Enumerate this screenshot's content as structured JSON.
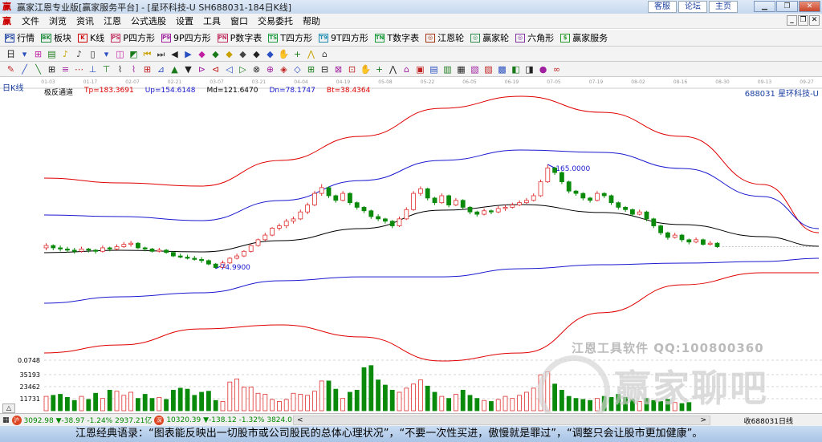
{
  "window": {
    "title": "赢家江恩专业版[赢家服务平台] - [星环科技-U  SH688031-184日K线]",
    "links": [
      "客服",
      "论坛",
      "主页"
    ],
    "controls": [
      "minimize",
      "restore",
      "close"
    ]
  },
  "menu": [
    "文件",
    "浏览",
    "资讯",
    "江恩",
    "公式选股",
    "设置",
    "工具",
    "窗口",
    "交易委托",
    "帮助"
  ],
  "toolbar1": [
    {
      "icon": "PS",
      "label": "行情",
      "color": "#1a3fa0"
    },
    {
      "icon": "BK",
      "label": "板块",
      "color": "#1a8a3a"
    },
    {
      "icon": "K",
      "label": "K线",
      "color": "#c00"
    },
    {
      "icon": "PS",
      "label": "P四方形",
      "color": "#c03060"
    },
    {
      "icon": "P9",
      "label": "9P四方形",
      "color": "#a020a0"
    },
    {
      "icon": "PN",
      "label": "P数字表",
      "color": "#c03060"
    },
    {
      "icon": "TS",
      "label": "T四方形",
      "color": "#1a9a3a"
    },
    {
      "icon": "T9",
      "label": "9T四方形",
      "color": "#1a8ab0"
    },
    {
      "icon": "TN",
      "label": "T数字表",
      "color": "#1a9a3a"
    },
    {
      "icon": "◎",
      "label": "江恩轮",
      "color": "#a03010"
    },
    {
      "icon": "◎",
      "label": "赢家轮",
      "color": "#2a8a4a"
    },
    {
      "icon": "◎",
      "label": "六角形",
      "color": "#8030a0"
    },
    {
      "icon": "$",
      "label": "赢家服务",
      "color": "#2a9a2a"
    }
  ],
  "toolbar2_icons": [
    "日",
    "▾",
    "⊞",
    "▤",
    "♪",
    "♪",
    "▯",
    "▾",
    "◫",
    "◩",
    "⏮",
    "⏭",
    "◀",
    "▶",
    "◆",
    "◆",
    "◆",
    "◆",
    "◆",
    "◆",
    "✋",
    "+",
    "⋀",
    "⌂"
  ],
  "toolbar3_icons": [
    "✎",
    "╱",
    "╲",
    "⊞",
    "≡",
    "⋯",
    "⊥",
    "⊤",
    "⌇",
    "⌇",
    "⊞",
    "⊿",
    "▲",
    "▼",
    "⊳",
    "⊲",
    "◁",
    "▷",
    "⊗",
    "⊕",
    "◈",
    "◇",
    "⊞",
    "⊟",
    "⊠",
    "⊡",
    "✋",
    "+",
    "⋀",
    "⌂",
    "▣",
    "▤",
    "▥",
    "▦",
    "▧",
    "▨",
    "▩",
    "◧",
    "◨",
    "●",
    "∞"
  ],
  "chart": {
    "period_label": "日K线",
    "indicator_name": "极反通道",
    "legend": [
      {
        "text": "Tp=183.3691",
        "color": "#e00000"
      },
      {
        "text": "Up=154.6148",
        "color": "#1a1ad0"
      },
      {
        "text": "Md=121.6470",
        "color": "#000000"
      },
      {
        "text": "Dn=78.1747",
        "color": "#1a1ad0"
      },
      {
        "text": "Bt=38.4364",
        "color": "#e00000"
      }
    ],
    "stock_label": "688031  星环科技-U",
    "high_label": "165.0000",
    "low_label": "74.9900",
    "watermark": {
      "line1": "江恩工具软件  QQ:100800360",
      "line2": "赢家聊吧",
      "seal": "财赢"
    }
  },
  "chart_data": {
    "type": "candlestick",
    "x_ticks": [
      "01-03",
      "01-17",
      "02-07",
      "02-21",
      "03-07",
      "03-21",
      "04-04",
      "04-19",
      "05-08",
      "05-22",
      "06-05",
      "06-19",
      "07-05",
      "07-19",
      "08-02",
      "08-16",
      "08-30",
      "09-13",
      "09-27"
    ],
    "candles": [
      [
        93,
        97,
        91,
        95
      ],
      [
        95,
        96,
        91,
        93
      ],
      [
        93,
        95,
        90,
        92
      ],
      [
        92,
        94,
        89,
        91
      ],
      [
        91,
        93,
        88,
        90
      ],
      [
        90,
        94,
        89,
        92
      ],
      [
        92,
        93,
        89,
        91
      ],
      [
        91,
        92,
        88,
        90
      ],
      [
        90,
        95,
        89,
        93
      ],
      [
        93,
        94,
        90,
        92
      ],
      [
        92,
        96,
        91,
        94
      ],
      [
        94,
        98,
        93,
        96
      ],
      [
        96,
        99,
        94,
        97
      ],
      [
        97,
        98,
        92,
        93
      ],
      [
        93,
        94,
        90,
        92
      ],
      [
        92,
        93,
        89,
        90
      ],
      [
        90,
        93,
        89,
        91
      ],
      [
        91,
        92,
        88,
        89
      ],
      [
        89,
        90,
        85,
        86
      ],
      [
        86,
        88,
        84,
        85
      ],
      [
        85,
        87,
        83,
        84
      ],
      [
        84,
        86,
        82,
        83
      ],
      [
        83,
        85,
        80,
        82
      ],
      [
        82,
        83,
        78,
        79
      ],
      [
        79,
        80,
        74.99,
        76
      ],
      [
        76,
        82,
        75,
        80
      ],
      [
        80,
        85,
        79,
        84
      ],
      [
        84,
        88,
        83,
        86
      ],
      [
        86,
        91,
        85,
        90
      ],
      [
        90,
        96,
        89,
        95
      ],
      [
        95,
        101,
        94,
        100
      ],
      [
        100,
        106,
        99,
        104
      ],
      [
        104,
        111,
        103,
        110
      ],
      [
        110,
        114,
        108,
        112
      ],
      [
        112,
        118,
        110,
        116
      ],
      [
        116,
        120,
        114,
        118
      ],
      [
        118,
        126,
        117,
        124
      ],
      [
        124,
        132,
        122,
        130
      ],
      [
        130,
        142,
        129,
        140
      ],
      [
        140,
        148,
        138,
        145
      ],
      [
        145,
        146,
        136,
        138
      ],
      [
        138,
        139,
        132,
        134
      ],
      [
        134,
        142,
        133,
        140
      ],
      [
        140,
        141,
        130,
        132
      ],
      [
        132,
        133,
        126,
        128
      ],
      [
        128,
        129,
        123,
        125
      ],
      [
        125,
        126,
        118,
        120
      ],
      [
        120,
        122,
        116,
        118
      ],
      [
        118,
        119,
        114,
        116
      ],
      [
        116,
        117,
        110,
        112
      ],
      [
        112,
        120,
        111,
        118
      ],
      [
        118,
        128,
        117,
        126
      ],
      [
        126,
        142,
        125,
        140
      ],
      [
        140,
        146,
        138,
        144
      ],
      [
        144,
        145,
        134,
        136
      ],
      [
        136,
        137,
        130,
        132
      ],
      [
        132,
        140,
        131,
        138
      ],
      [
        138,
        139,
        128,
        130
      ],
      [
        130,
        136,
        129,
        134
      ],
      [
        134,
        135,
        126,
        128
      ],
      [
        128,
        129,
        122,
        124
      ],
      [
        124,
        125,
        120,
        122
      ],
      [
        122,
        127,
        121,
        125
      ],
      [
        125,
        126,
        122,
        124
      ],
      [
        124,
        129,
        123,
        127
      ],
      [
        127,
        130,
        125,
        128
      ],
      [
        128,
        132,
        127,
        130
      ],
      [
        130,
        134,
        129,
        132
      ],
      [
        132,
        136,
        131,
        134
      ],
      [
        134,
        140,
        133,
        138
      ],
      [
        138,
        152,
        137,
        150
      ],
      [
        150,
        165,
        149,
        162
      ],
      [
        162,
        163,
        156,
        158
      ],
      [
        158,
        159,
        148,
        150
      ],
      [
        150,
        151,
        140,
        142
      ],
      [
        142,
        143,
        138,
        140
      ],
      [
        140,
        141,
        134,
        136
      ],
      [
        136,
        137,
        132,
        134
      ],
      [
        134,
        142,
        133,
        140
      ],
      [
        140,
        141,
        136,
        138
      ],
      [
        138,
        139,
        130,
        132
      ],
      [
        132,
        133,
        126,
        128
      ],
      [
        128,
        129,
        124,
        126
      ],
      [
        126,
        127,
        120,
        122
      ],
      [
        122,
        126,
        121,
        124
      ],
      [
        124,
        125,
        116,
        118
      ],
      [
        118,
        119,
        110,
        112
      ],
      [
        112,
        113,
        104,
        106
      ],
      [
        106,
        107,
        100,
        102
      ],
      [
        102,
        106,
        101,
        104
      ],
      [
        104,
        105,
        98,
        100
      ],
      [
        100,
        101,
        96,
        98
      ],
      [
        98,
        102,
        97,
        100
      ],
      [
        100,
        101,
        95,
        96
      ],
      [
        96,
        99,
        95,
        97
      ],
      [
        97,
        98,
        93,
        94
      ]
    ],
    "volume": [
      14000,
      15000,
      16000,
      13000,
      10000,
      14000,
      11000,
      17000,
      12000,
      20000,
      19000,
      15000,
      18000,
      12000,
      16000,
      12000,
      13000,
      11000,
      20000,
      22000,
      21000,
      15000,
      18000,
      19000,
      10000,
      9000,
      28000,
      31000,
      23000,
      23000,
      17000,
      16000,
      11000,
      9000,
      11000,
      17000,
      16000,
      15000,
      19000,
      29000,
      29000,
      21000,
      12000,
      18000,
      20000,
      42000,
      44000,
      30000,
      25000,
      20000,
      18000,
      22000,
      26000,
      30000,
      24000,
      18000,
      14000,
      12000,
      16000,
      20000,
      15000,
      12000,
      10000,
      9000,
      11000,
      14000,
      12000,
      15000,
      18000,
      22000,
      35000,
      38000,
      26000,
      20000,
      14000,
      12000,
      11000,
      10000,
      12000,
      14000,
      13000,
      16000,
      13000,
      11000,
      9000,
      12000,
      10000,
      9000,
      11000,
      8000,
      7000,
      8000
    ],
    "volume_ticks": [
      "11731",
      "23462",
      "35193"
    ],
    "volume_top_label": "0.0748",
    "bands": {
      "tp": [
        153.2,
        149.1,
        146.3,
        168.5,
        189.2,
        213.5,
        223.9,
        210.0,
        189.2,
        147.7,
        106.1
      ],
      "up": [
        121.4,
        120.0,
        116.5,
        133.8,
        151.1,
        168.5,
        177.5,
        175.4,
        161.5,
        137.3,
        109.6
      ],
      "md": [
        88.8,
        90.9,
        89.5,
        99.2,
        109.6,
        125.5,
        130.4,
        123.5,
        113.1,
        102.7,
        94.4
      ],
      "dn": [
        45.2,
        50.7,
        54.2,
        64.6,
        68.0,
        68.0,
        75.0,
        78.4,
        79.8,
        81.2,
        84.0
      ],
      "bt": [
        2.3,
        9.2,
        23.0,
        26.5,
        16.1,
        -4.7,
        2.3,
        37.0,
        61.1,
        71.5,
        71.5
      ]
    },
    "colors": {
      "up": "#e03030",
      "down": "#0a8a0a",
      "tp": "#e00000",
      "upband": "#1a1ad0",
      "md": "#000000",
      "dn": "#1a1ad0",
      "bt": "#e00000"
    }
  },
  "statusbar": {
    "sh_badge": "沪",
    "sh_quote": "3092.98 ▼-38.97 -1.24% 2937.21亿",
    "sz_badge": "深",
    "sz_quote": "10320.39 ▼-138.12 -1.32% 3824.0",
    "right_text": "收688031日线"
  },
  "banner": "江恩经典语录：“图表能反映出一切股市或公司股民的总体心理状况”，“不要一次性买进，傲慢就是罪过”，“调整只会让股市更加健康”。"
}
